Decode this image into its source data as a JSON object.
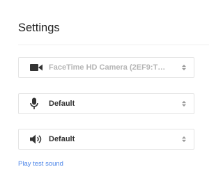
{
  "title": "Settings",
  "devices": {
    "camera": {
      "label": "FaceTime HD Camera (2EF9:T…",
      "icon": "video-camera-icon",
      "disabled": true
    },
    "microphone": {
      "label": "Default",
      "icon": "microphone-icon"
    },
    "speaker": {
      "label": "Default",
      "icon": "speaker-icon"
    }
  },
  "test_sound_label": "Play test sound",
  "colors": {
    "link": "#4a84e8",
    "icon": "#333333",
    "disabled": "#b5b5b5",
    "border": "#e4e4e4"
  }
}
